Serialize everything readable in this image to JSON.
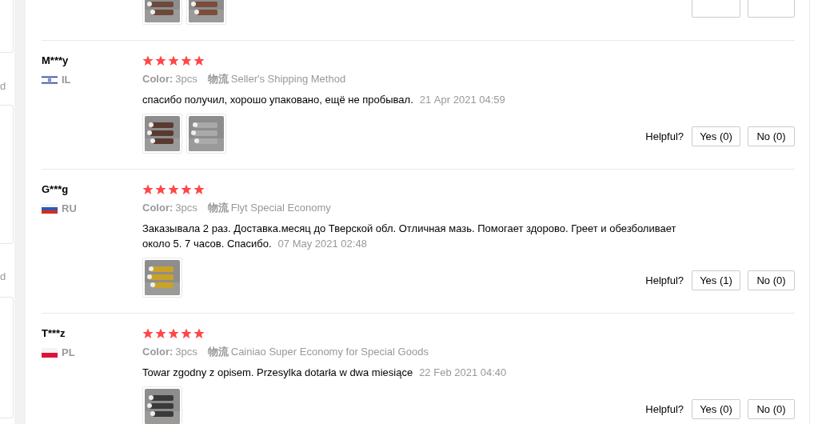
{
  "sidebar": {
    "fragments": [
      "d",
      "d"
    ]
  },
  "partial_review": {
    "photos": [
      {
        "kind": "picture"
      },
      {
        "kind": "picture"
      }
    ],
    "votes": [
      {
        "kind": "yes"
      },
      {
        "kind": "no"
      }
    ]
  },
  "reviews": [
    {
      "name": "M***y",
      "country": "IL",
      "stars": 5,
      "option_label": "Color:",
      "option": "3pcs",
      "shipping_label": "物流",
      "shipping": "Seller's Shipping Method",
      "text": "спасибо получил, хорошо упаковано, ещё не пробывал.",
      "date": "21 Apr 2021 04:59",
      "photos": [
        {
          "kind": "picture"
        },
        {
          "kind": "picture"
        }
      ],
      "helpful_label": "Helpful?",
      "yes": "Yes (0)",
      "no": "No (0)"
    },
    {
      "name": "G***g",
      "country": "RU",
      "stars": 5,
      "option_label": "Color:",
      "option": "3pcs",
      "shipping_label": "物流",
      "shipping": "Flyt Special Economy",
      "text": "Заказывала 2 раз. Доставка.месяц до Тверской обл. Отличная мазь. Помогает здорово. Греет и обезболивает около 5. 7 часов. Спасибо.",
      "date": "07 May 2021 02:48",
      "photos": [
        {
          "kind": "picture"
        }
      ],
      "helpful_label": "Helpful?",
      "yes": "Yes (1)",
      "no": "No (0)"
    },
    {
      "name": "T***z",
      "country": "PL",
      "stars": 5,
      "option_label": "Color:",
      "option": "3pcs",
      "shipping_label": "物流",
      "shipping": "Cainiao Super Economy for Special Goods",
      "text": "Towar zgodny z opisem. Przesylka dotarła w dwa miesiące",
      "date": "22 Feb 2021 04:40",
      "photos": [
        {
          "kind": "picture"
        }
      ],
      "helpful_label": "Helpful?",
      "yes": "Yes (0)",
      "no": "No (0)"
    }
  ]
}
